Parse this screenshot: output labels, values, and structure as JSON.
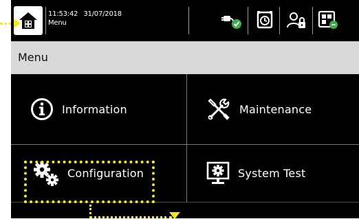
{
  "status_bar": {
    "time": "11:53:42",
    "date": "31/07/2018",
    "screen": "Menu",
    "icons": [
      "home-icon",
      "power-ok-icon",
      "timer-icon",
      "user-lock-icon",
      "panel-status-icon"
    ]
  },
  "title_bar": {
    "title": "Menu"
  },
  "menu": {
    "items": [
      {
        "label": "Information",
        "icon": "info-icon"
      },
      {
        "label": "Maintenance",
        "icon": "tools-icon"
      },
      {
        "label": "Configuration",
        "icon": "gears-icon"
      },
      {
        "label": "System Test",
        "icon": "monitor-gear-icon"
      }
    ]
  },
  "colors": {
    "background": "#000000",
    "title_bar": "#d9d9d9",
    "annotation": "#f2ea1a",
    "ok_green": "#3fae49"
  }
}
